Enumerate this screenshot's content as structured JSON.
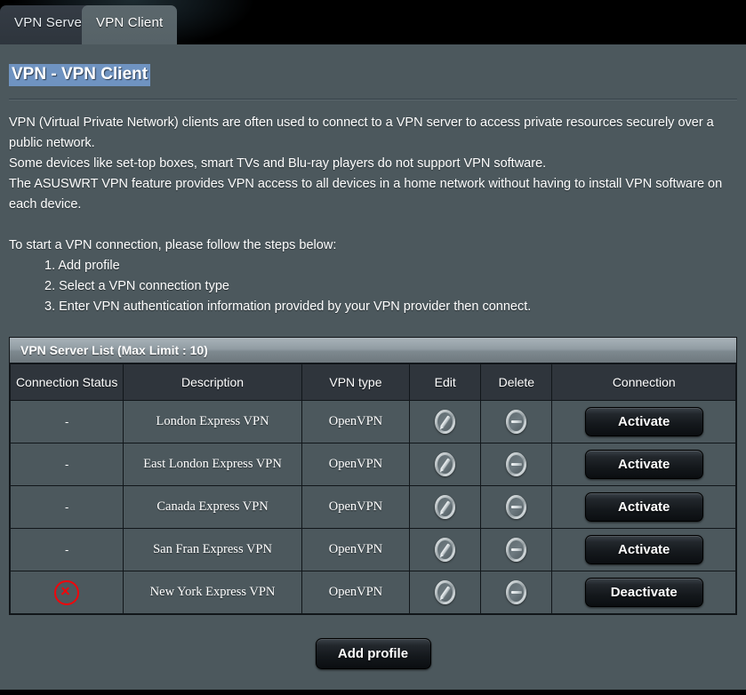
{
  "tabs": [
    {
      "label": "VPN Server",
      "active": false
    },
    {
      "label": "VPN Client",
      "active": true
    }
  ],
  "page": {
    "title": "VPN - VPN Client",
    "intro_lines": [
      "VPN (Virtual Private Network) clients are often used to connect to a VPN server to access private resources securely over a public network.",
      "Some devices like set-top boxes, smart TVs and Blu-ray players do not support VPN software.",
      "The ASUSWRT VPN feature provides VPN access to all devices in a home network without having to install VPN software on each device."
    ],
    "steps_intro": "To start a VPN connection, please follow the steps below:",
    "steps": [
      "1. Add profile",
      "2. Select a VPN connection type",
      "3. Enter VPN authentication information provided by your VPN provider then connect."
    ]
  },
  "table": {
    "header": "VPN Server List (Max Limit : 10)",
    "columns": [
      "Connection Status",
      "Description",
      "VPN type",
      "Edit",
      "Delete",
      "Connection"
    ],
    "rows": [
      {
        "status": "-",
        "status_icon": "none",
        "description": "London Express VPN",
        "vpn_type": "OpenVPN",
        "edit_icon": "pencil-icon",
        "delete_icon": "minus-circle-icon",
        "connection_label": "Activate"
      },
      {
        "status": "-",
        "status_icon": "none",
        "description": "East London Express VPN",
        "vpn_type": "OpenVPN",
        "edit_icon": "pencil-icon",
        "delete_icon": "minus-circle-icon",
        "connection_label": "Activate"
      },
      {
        "status": "-",
        "status_icon": "none",
        "description": "Canada Express VPN",
        "vpn_type": "OpenVPN",
        "edit_icon": "pencil-icon",
        "delete_icon": "minus-circle-icon",
        "connection_label": "Activate"
      },
      {
        "status": "-",
        "status_icon": "none",
        "description": "San Fran Express VPN",
        "vpn_type": "OpenVPN",
        "edit_icon": "pencil-icon",
        "delete_icon": "minus-circle-icon",
        "connection_label": "Activate"
      },
      {
        "status": "",
        "status_icon": "error-x-circle-icon",
        "description": "New York Express VPN",
        "vpn_type": "OpenVPN",
        "edit_icon": "pencil-icon",
        "delete_icon": "minus-circle-icon",
        "connection_label": "Deactivate"
      }
    ]
  },
  "footer": {
    "add_profile_label": "Add profile"
  },
  "colors": {
    "panel_bg": "#4c585d",
    "tab_active_bg": "#586469",
    "tab_inactive_bg": "#323942",
    "title_highlight": "#6f93c1",
    "table_header_bg": "#2f353c",
    "status_error": "#f0060b"
  }
}
